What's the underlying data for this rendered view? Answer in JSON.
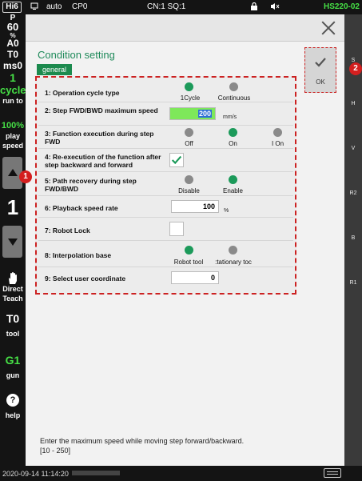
{
  "status": {
    "logo": "Hi6",
    "mode": "auto",
    "cp": "CP0",
    "cnsq": "CN:1 SQ:1",
    "model": "HS220-02"
  },
  "left": {
    "p_label": "P",
    "speed_value": "60",
    "percent_sign": "%",
    "au": "A0",
    "t0": "T0",
    "ms0": "ms0",
    "cycle_number": "1",
    "cycle_label": "cycle",
    "run_to": "run to",
    "play_speed_value": "100%",
    "play_label": "play",
    "speed_label": "speed",
    "step_number": "1",
    "direct_label": "Direct",
    "teach_label": "Teach",
    "tool_value": "T0",
    "tool_label": "tool",
    "gun_value": "G1",
    "gun_label": "gun",
    "help_label": "help"
  },
  "right": [
    "S",
    "H",
    "V",
    "R2",
    "B",
    "R1"
  ],
  "dialog": {
    "title": "Condition setting",
    "tab": "general",
    "ok_label": "OK",
    "rows": [
      {
        "label": "1: Operation cycle type",
        "options": [
          "1Cycle",
          "Continuous"
        ],
        "selected": 0
      },
      {
        "label": "2: Step FWD/BWD maximum speed",
        "value": "200",
        "unit": "mm/s"
      },
      {
        "label": "3: Function execution during step FWD",
        "options": [
          "Off",
          "On",
          "I On"
        ],
        "selected": 1
      },
      {
        "label": "4: Re-execution of the function after step backward and forward",
        "checked": true
      },
      {
        "label": "5: Path recovery during step FWD/BWD",
        "options": [
          "Disable",
          "Enable"
        ],
        "selected": 1
      },
      {
        "label": "6: Playback speed rate",
        "value": "100",
        "unit": "%"
      },
      {
        "label": "7: Robot Lock",
        "checked": false
      },
      {
        "label": "8: Interpolation base",
        "options": [
          "Robot tool",
          ":tationary toc"
        ],
        "selected": 0
      },
      {
        "label": "9: Select user coordinate",
        "value": "0"
      }
    ],
    "help_text": "Enter the maximum speed while moving step forward/backward.",
    "help_range": "[10 - 250]"
  },
  "badges": [
    "1",
    "2"
  ],
  "bottom": {
    "datetime": "2020-09-14 11:14:20"
  },
  "colors": {
    "accent": "#1c9a5a",
    "annotation": "#cc2222",
    "highlight": "#7ee85a"
  }
}
